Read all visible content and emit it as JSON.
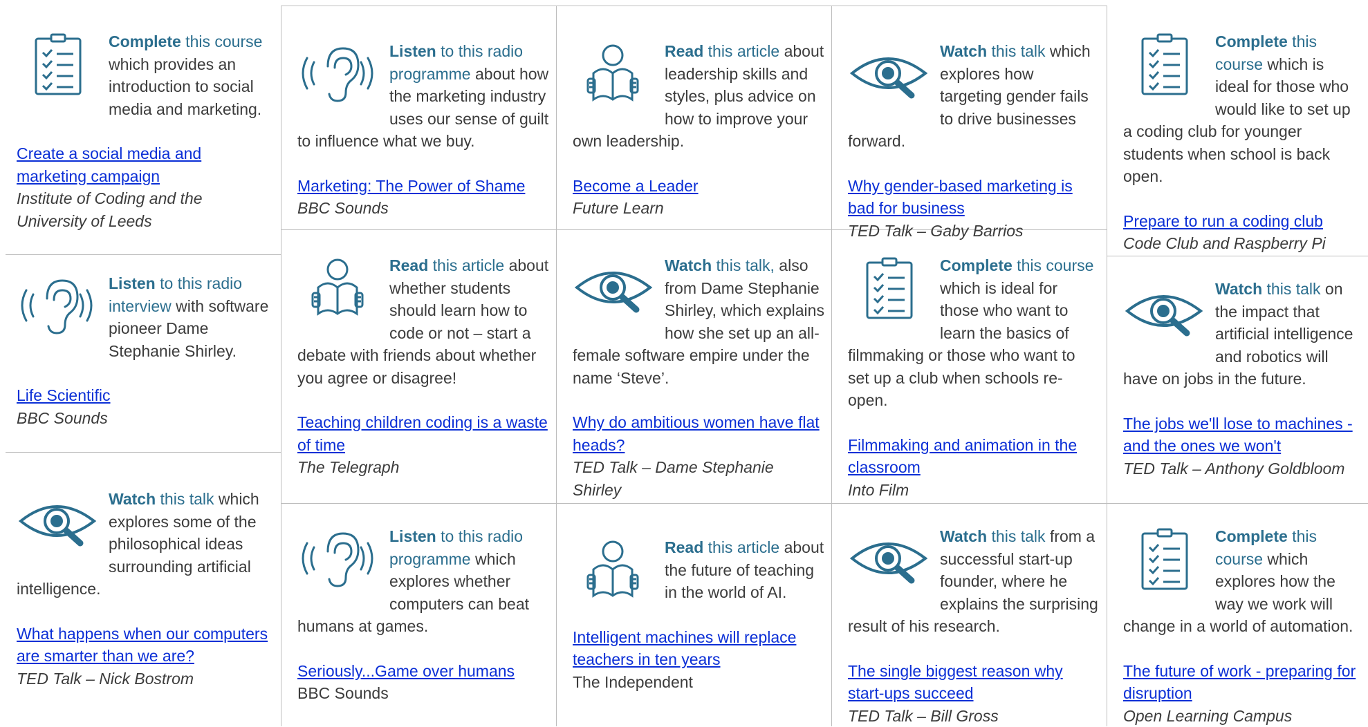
{
  "colors": {
    "accent": "#2b6e8e",
    "link": "#0b2fd6",
    "text": "#3c3c3c",
    "grid": "#bdbdbd"
  },
  "cards": [
    {
      "id": "c1",
      "icon": "clipboard-checklist-icon",
      "verb": "Complete",
      "kind": " this course",
      "rest": " which provides an introduction to social media and marketing.",
      "link": "Create a social media and marketing campaign",
      "source": "Institute of Coding and the University of Leeds",
      "source_italic": true
    },
    {
      "id": "c2",
      "icon": "ear-listen-icon",
      "verb": "Listen",
      "kind": " to this radio interview",
      "rest": " with software pioneer Dame Stephanie Shirley.",
      "link": "Life Scientific",
      "source": "BBC Sounds",
      "source_italic": true
    },
    {
      "id": "c3",
      "icon": "eye-watch-icon",
      "verb": "Watch",
      "kind": " this talk",
      "rest": " which explores some of the philosophical ideas surrounding artificial intelligence.",
      "link": "What happens when our computers are smarter than we are?",
      "source": "TED Talk – Nick Bostrom",
      "source_italic": true
    },
    {
      "id": "c4",
      "icon": "ear-listen-icon",
      "verb": "Listen",
      "kind": " to this radio programme",
      "rest": " about how the marketing industry uses our sense of guilt to influence what we buy.",
      "link": "Marketing: The Power of Shame",
      "source": "BBC Sounds",
      "source_italic": true
    },
    {
      "id": "c5",
      "icon": "reader-book-icon",
      "verb": "Read",
      "kind": " this article",
      "rest": " about whether students should learn how to code or not – start a debate with friends about whether you agree or disagree!",
      "link": "Teaching children coding is a waste of time",
      "source": "The Telegraph",
      "source_italic": true
    },
    {
      "id": "c6",
      "icon": "ear-listen-icon",
      "verb": "Listen",
      "kind": " to this radio programme",
      "rest": " which explores whether computers can beat humans at games.",
      "link": "Seriously...Game over humans",
      "source": "BBC Sounds",
      "source_italic": false
    },
    {
      "id": "c7",
      "icon": "reader-book-icon",
      "verb": "Read",
      "kind": " this article",
      "rest": " about leadership skills and styles, plus advice on how to improve your own leadership.",
      "link": "Become a Leader",
      "source": "Future Learn",
      "source_italic": true
    },
    {
      "id": "c8",
      "icon": "eye-watch-icon",
      "verb": "Watch",
      "kind": " this talk,",
      "rest": " also from Dame Stephanie Shirley, which explains how she set up an all-female software empire under the name ‘Steve’.",
      "link": "Why do ambitious women have flat heads?",
      "source": "TED Talk – Dame Stephanie Shirley",
      "source_italic": true
    },
    {
      "id": "c9",
      "icon": "reader-book-icon",
      "verb": "Read",
      "kind": " this article",
      "rest": " about the future of teaching in the world of AI.",
      "link": "Intelligent machines will replace teachers in ten years",
      "source": "The Independent",
      "source_italic": false
    },
    {
      "id": "c10",
      "icon": "eye-watch-icon",
      "verb": "Watch",
      "kind": " this talk",
      "rest": " which explores how targeting gender fails to drive businesses forward.",
      "link": "Why gender-based marketing is bad for business",
      "source": "TED Talk – Gaby Barrios",
      "source_italic": true
    },
    {
      "id": "c11",
      "icon": "clipboard-checklist-icon",
      "verb": "Complete",
      "kind": " this course",
      "rest": " which is ideal for those who want to learn the basics of filmmaking or those who want to set up a club when schools re-open.",
      "link": "Filmmaking and animation in the classroom",
      "source": "Into Film",
      "source_italic": true
    },
    {
      "id": "c12",
      "icon": "eye-watch-icon",
      "verb": "Watch",
      "kind": " this talk",
      "rest": " from a successful start-up founder, where he explains the surprising result of his research.",
      "link": "The single biggest reason why start-ups succeed",
      "source": "TED Talk – Bill Gross",
      "source_italic": true
    },
    {
      "id": "c13",
      "icon": "clipboard-checklist-icon",
      "verb": "Complete",
      "kind": " this course",
      "rest": " which is ideal for those who would like to set up a coding club for younger students when school is back open.",
      "link": "Prepare to run a coding club",
      "source": "Code Club and Raspberry Pi",
      "source_italic": true
    },
    {
      "id": "c14",
      "icon": "eye-watch-icon",
      "verb": "Watch",
      "kind": " this talk",
      "rest": " on the impact that artificial intelligence and robotics will have on jobs in the future.",
      "link": "The jobs we'll lose to machines - and the ones we won't",
      "source": "TED Talk – Anthony Goldbloom",
      "source_italic": true
    },
    {
      "id": "c15",
      "icon": "clipboard-checklist-icon",
      "verb": "Complete",
      "kind": " this course",
      "rest": " which explores how the way we work will change in a world of automation.",
      "link": "The future of work - preparing for disruption",
      "source": "Open Learning Campus",
      "source_italic": true
    }
  ]
}
